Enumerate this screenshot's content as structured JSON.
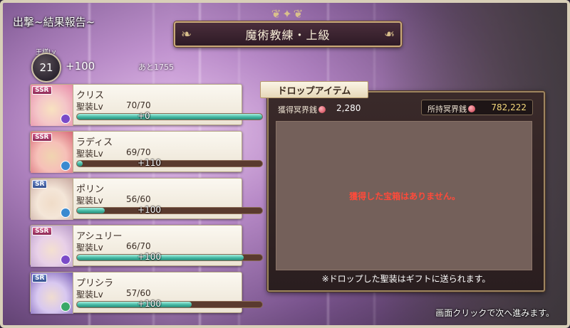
{
  "header": {
    "screen_title": "出撃~結果報告~",
    "stage_name": "魔術教練・上級"
  },
  "player": {
    "level_tag": "王様Lv",
    "level": "21",
    "exp_gain": "+100",
    "exp_remaining": "あと1755"
  },
  "characters": [
    {
      "rarity": "SSR",
      "name": "クリス",
      "level_label": "聖装Lv",
      "level_value": "70/70",
      "gain": "+0",
      "fill": 1.0,
      "element_color": "#7a4ac8"
    },
    {
      "rarity": "SSR",
      "name": "ラディス",
      "level_label": "聖装Lv",
      "level_value": "69/70",
      "gain": "+110",
      "fill": 0.03,
      "element_color": "#3a8ad0"
    },
    {
      "rarity": "SR",
      "name": "ポリン",
      "level_label": "聖装Lv",
      "level_value": "56/60",
      "gain": "+100",
      "fill": 0.15,
      "element_color": "#3a8ad0"
    },
    {
      "rarity": "SSR",
      "name": "アシュリー",
      "level_label": "聖装Lv",
      "level_value": "66/70",
      "gain": "+100",
      "fill": 0.9,
      "element_color": "#7a4ac8"
    },
    {
      "rarity": "SR",
      "name": "プリシラ",
      "level_label": "聖装Lv",
      "level_value": "57/60",
      "gain": "+100",
      "fill": 0.62,
      "element_color": "#3aa868"
    }
  ],
  "drops": {
    "tab_label": "ドロップアイテム",
    "earned_label": "獲得冥界銭",
    "earned_value": "2,280",
    "owned_label": "所持冥界銭",
    "owned_value": "782,222",
    "empty_message": "獲得した宝箱はありません。",
    "note": "※ドロップした聖装はギフトに送られます。"
  },
  "footer": {
    "hint": "画面クリックで次へ進みます。"
  }
}
